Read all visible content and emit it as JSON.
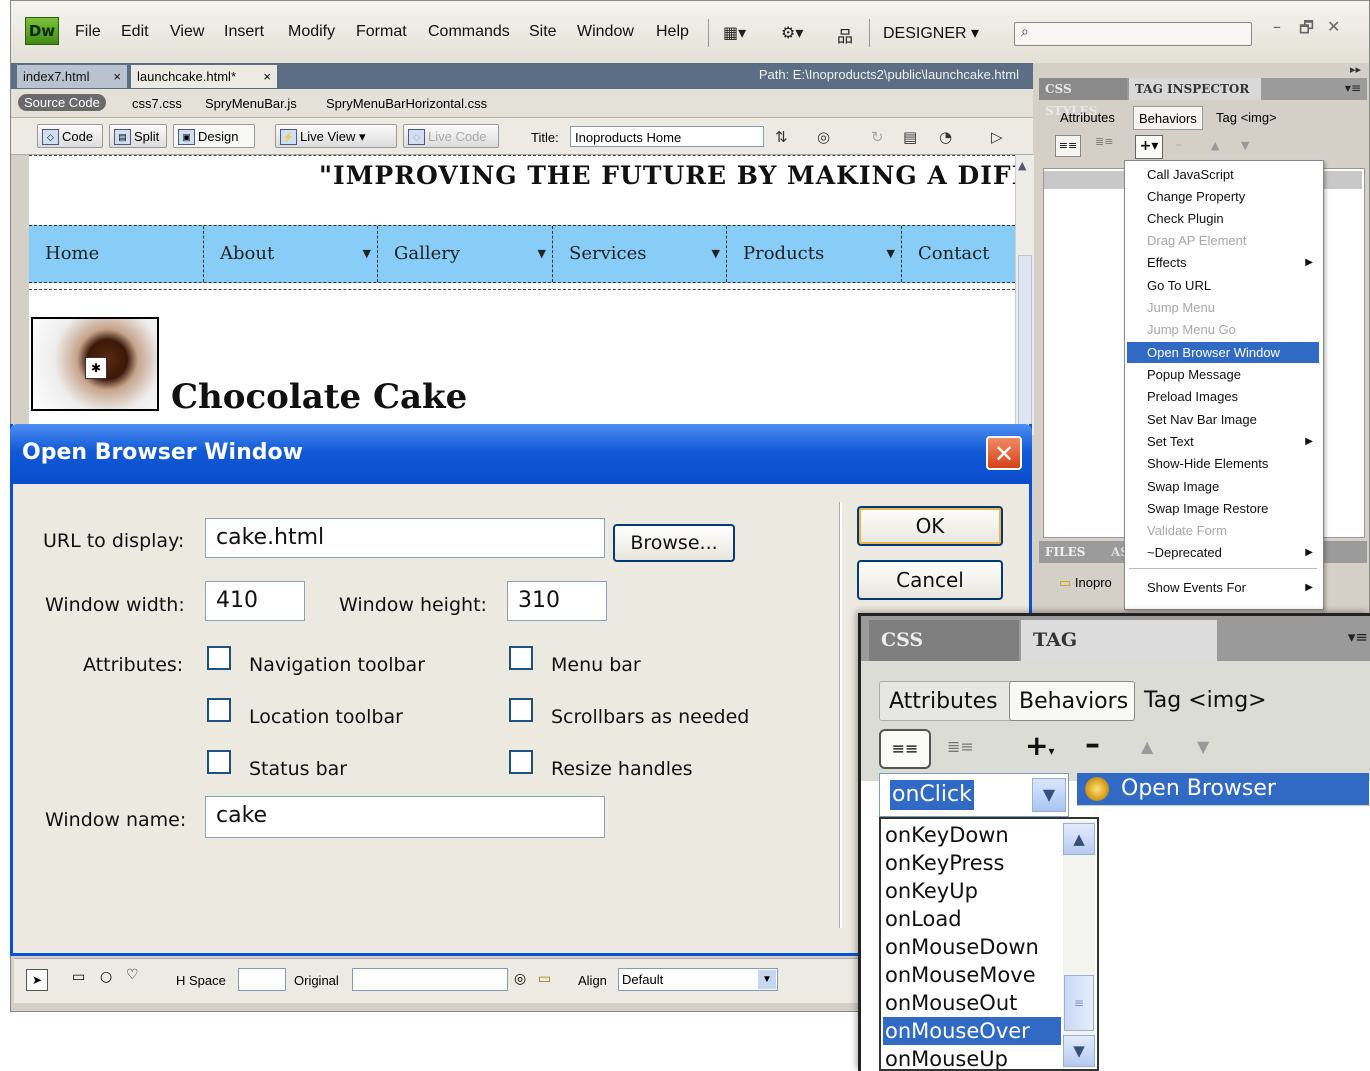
{
  "app": {
    "logo": "Dw",
    "menu": [
      "File",
      "Edit",
      "View",
      "Insert",
      "Modify",
      "Format",
      "Commands",
      "Site",
      "Window",
      "Help"
    ],
    "workspace": "DESIGNER",
    "colors": {
      "accent": "#316ac5",
      "dialog_title": "#0a4dcc",
      "nav_bg": "#87cdf7"
    }
  },
  "doc_tabs": [
    {
      "label": "index7.html",
      "close": "×"
    },
    {
      "label": "launchcake.html*",
      "close": "×"
    }
  ],
  "path_text": "Path:  E:\\Inoproducts2\\public\\launchcake.html",
  "related_files": {
    "source": "Source Code",
    "files": [
      "css7.css",
      "SpryMenuBar.js",
      "SpryMenuBarHorizontal.css"
    ]
  },
  "doc_toolbar": {
    "code": "Code",
    "split": "Split",
    "design": "Design",
    "live_view": "Live View",
    "live_code": "Live Code",
    "title_label": "Title:",
    "title_value": "Inoproducts Home"
  },
  "page": {
    "motto": "\"IMPROVING THE FUTURE BY MAKING A DIFFI",
    "nav": [
      {
        "label": "Home",
        "arrow": ""
      },
      {
        "label": "About",
        "arrow": "▼"
      },
      {
        "label": "Gallery",
        "arrow": "▼"
      },
      {
        "label": "Services",
        "arrow": "▼"
      },
      {
        "label": "Products",
        "arrow": "▼"
      },
      {
        "label": "Contact",
        "arrow": ""
      }
    ],
    "heading": "Chocolate Cake"
  },
  "right_panel": {
    "tabs": [
      "CSS STYLES",
      "TAG INSPECTOR"
    ],
    "subtabs": [
      "Attributes",
      "Behaviors"
    ],
    "tag": "Tag <img>",
    "files_tab": "FILES",
    "assets_tab": "AS",
    "site": "Inopro"
  },
  "behaviors_menu": [
    {
      "label": "Call JavaScript",
      "state": "normal",
      "sub": ""
    },
    {
      "label": "Change Property",
      "state": "normal",
      "sub": ""
    },
    {
      "label": "Check Plugin",
      "state": "normal",
      "sub": ""
    },
    {
      "label": "Drag AP Element",
      "state": "disabled",
      "sub": ""
    },
    {
      "label": "Effects",
      "state": "normal",
      "sub": "▶"
    },
    {
      "label": "Go To URL",
      "state": "normal",
      "sub": ""
    },
    {
      "label": "Jump Menu",
      "state": "disabled",
      "sub": ""
    },
    {
      "label": "Jump Menu Go",
      "state": "disabled",
      "sub": ""
    },
    {
      "label": "Open Browser Window",
      "state": "highlighted",
      "sub": ""
    },
    {
      "label": "Popup Message",
      "state": "normal",
      "sub": ""
    },
    {
      "label": "Preload Images",
      "state": "normal",
      "sub": ""
    },
    {
      "label": "Set Nav Bar Image",
      "state": "normal",
      "sub": ""
    },
    {
      "label": "Set Text",
      "state": "normal",
      "sub": "▶"
    },
    {
      "label": "Show-Hide Elements",
      "state": "normal",
      "sub": ""
    },
    {
      "label": "Swap Image",
      "state": "normal",
      "sub": ""
    },
    {
      "label": "Swap Image Restore",
      "state": "normal",
      "sub": ""
    },
    {
      "label": "Validate Form",
      "state": "disabled",
      "sub": ""
    },
    {
      "label": "~Deprecated",
      "state": "normal",
      "sub": "▶"
    },
    {
      "label": "Show Events For",
      "state": "normal",
      "sub": "▶"
    }
  ],
  "dialog": {
    "title": "Open Browser Window",
    "url_label": "URL to display:",
    "url_value": "cake.html",
    "browse": "Browse...",
    "width_label": "Window width:",
    "width_value": "410",
    "height_label": "Window height:",
    "height_value": "310",
    "attributes_label": "Attributes:",
    "checkboxes": [
      {
        "label": "Navigation toolbar",
        "checked": false
      },
      {
        "label": "Menu bar",
        "checked": false
      },
      {
        "label": "Location toolbar",
        "checked": false
      },
      {
        "label": "Scrollbars as needed",
        "checked": false
      },
      {
        "label": "Status bar",
        "checked": false
      },
      {
        "label": "Resize handles",
        "checked": false
      }
    ],
    "name_label": "Window name:",
    "name_value": "cake",
    "ok": "OK",
    "cancel": "Cancel"
  },
  "prop_bar": {
    "hspace": "H Space",
    "original": "Original",
    "align": "Align",
    "align_value": "Default"
  },
  "zoom_inspector": {
    "tabs": [
      "CSS STYLES",
      "TAG INSPECTOR"
    ],
    "subtabs": [
      "Attributes",
      "Behaviors"
    ],
    "tag": "Tag <img>",
    "event": "onClick",
    "action": "Open Browser Window",
    "events": [
      "onKeyDown",
      "onKeyPress",
      "onKeyUp",
      "onLoad",
      "onMouseDown",
      "onMouseMove",
      "onMouseOut",
      "onMouseOver",
      "onMouseUp"
    ],
    "selected_event": "onMouseOver"
  }
}
